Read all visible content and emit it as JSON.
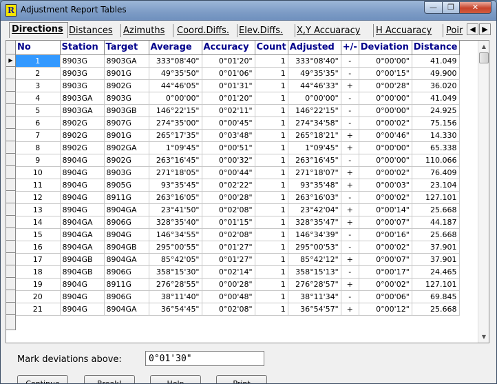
{
  "window": {
    "title": "Adjustment Report Tables",
    "icon_letter": "R",
    "minimize_glyph": "—",
    "maximize_glyph": "❐",
    "close_glyph": "✕"
  },
  "tabs": [
    {
      "label": "Directions",
      "active": true
    },
    {
      "label": "Distances"
    },
    {
      "label": "Azimuths"
    },
    {
      "label": "Coord.Diffs."
    },
    {
      "label": "Elev.Diffs."
    },
    {
      "label": "X,Y Accuaracy"
    },
    {
      "label": "H Accuaracy"
    },
    {
      "label": "Poir"
    }
  ],
  "table": {
    "columns": [
      "No",
      "Station",
      "Target",
      "Average",
      "Accuracy",
      "Count",
      "Adjusted",
      "+/-",
      "Deviation",
      "Distance"
    ],
    "current_row_marker": "▶",
    "rows": [
      [
        "1",
        "8903G",
        "8903GA",
        "333°08'40\"",
        "0°01'20\"",
        "1",
        "333°08'40\"",
        "-",
        "0°00'00\"",
        "41.049"
      ],
      [
        "2",
        "8903G",
        "8901G",
        "49°35'50\"",
        "0°01'06\"",
        "1",
        "49°35'35\"",
        "-",
        "0°00'15\"",
        "49.900"
      ],
      [
        "3",
        "8903G",
        "8902G",
        "44°46'05\"",
        "0°01'31\"",
        "1",
        "44°46'33\"",
        "+",
        "0°00'28\"",
        "36.020"
      ],
      [
        "4",
        "8903GA",
        "8903G",
        "0°00'00\"",
        "0°01'20\"",
        "1",
        "0°00'00\"",
        "-",
        "0°00'00\"",
        "41.049"
      ],
      [
        "5",
        "8903GA",
        "8903GB",
        "146°22'15\"",
        "0°02'11\"",
        "1",
        "146°22'15\"",
        "-",
        "0°00'00\"",
        "24.925"
      ],
      [
        "6",
        "8902G",
        "8907G",
        "274°35'00\"",
        "0°00'45\"",
        "1",
        "274°34'58\"",
        "-",
        "0°00'02\"",
        "75.156"
      ],
      [
        "7",
        "8902G",
        "8901G",
        "265°17'35\"",
        "0°03'48\"",
        "1",
        "265°18'21\"",
        "+",
        "0°00'46\"",
        "14.330"
      ],
      [
        "8",
        "8902G",
        "8902GA",
        "1°09'45\"",
        "0°00'51\"",
        "1",
        "1°09'45\"",
        "+",
        "0°00'00\"",
        "65.338"
      ],
      [
        "9",
        "8904G",
        "8902G",
        "263°16'45\"",
        "0°00'32\"",
        "1",
        "263°16'45\"",
        "-",
        "0°00'00\"",
        "110.066"
      ],
      [
        "10",
        "8904G",
        "8903G",
        "271°18'05\"",
        "0°00'44\"",
        "1",
        "271°18'07\"",
        "+",
        "0°00'02\"",
        "76.409"
      ],
      [
        "11",
        "8904G",
        "8905G",
        "93°35'45\"",
        "0°02'22\"",
        "1",
        "93°35'48\"",
        "+",
        "0°00'03\"",
        "23.104"
      ],
      [
        "12",
        "8904G",
        "8911G",
        "263°16'05\"",
        "0°00'28\"",
        "1",
        "263°16'03\"",
        "-",
        "0°00'02\"",
        "127.101"
      ],
      [
        "13",
        "8904G",
        "8904GA",
        "23°41'50\"",
        "0°02'08\"",
        "1",
        "23°42'04\"",
        "+",
        "0°00'14\"",
        "25.668"
      ],
      [
        "14",
        "8904GA",
        "8906G",
        "328°35'40\"",
        "0°01'15\"",
        "1",
        "328°35'47\"",
        "+",
        "0°00'07\"",
        "44.187"
      ],
      [
        "15",
        "8904GA",
        "8904G",
        "146°34'55\"",
        "0°02'08\"",
        "1",
        "146°34'39\"",
        "-",
        "0°00'16\"",
        "25.668"
      ],
      [
        "16",
        "8904GA",
        "8904GB",
        "295°00'55\"",
        "0°01'27\"",
        "1",
        "295°00'53\"",
        "-",
        "0°00'02\"",
        "37.901"
      ],
      [
        "17",
        "8904GB",
        "8904GA",
        "85°42'05\"",
        "0°01'27\"",
        "1",
        "85°42'12\"",
        "+",
        "0°00'07\"",
        "37.901"
      ],
      [
        "18",
        "8904GB",
        "8906G",
        "358°15'30\"",
        "0°02'14\"",
        "1",
        "358°15'13\"",
        "-",
        "0°00'17\"",
        "24.465"
      ],
      [
        "19",
        "8904G",
        "8911G",
        "276°28'55\"",
        "0°00'28\"",
        "1",
        "276°28'57\"",
        "+",
        "0°00'02\"",
        "127.101"
      ],
      [
        "20",
        "8904G",
        "8906G",
        "38°11'40\"",
        "0°00'48\"",
        "1",
        "38°11'34\"",
        "-",
        "0°00'06\"",
        "69.845"
      ],
      [
        "21",
        "8904G",
        "8904GA",
        "36°54'45\"",
        "0°02'08\"",
        "1",
        "36°54'57\"",
        "+",
        "0°00'12\"",
        "25.668"
      ]
    ]
  },
  "mark_deviations": {
    "label": "Mark deviations above:",
    "value": "0°01'30\""
  },
  "buttons": {
    "continue": "Continue",
    "break": "Break!",
    "help": "Help",
    "print": "Print"
  }
}
